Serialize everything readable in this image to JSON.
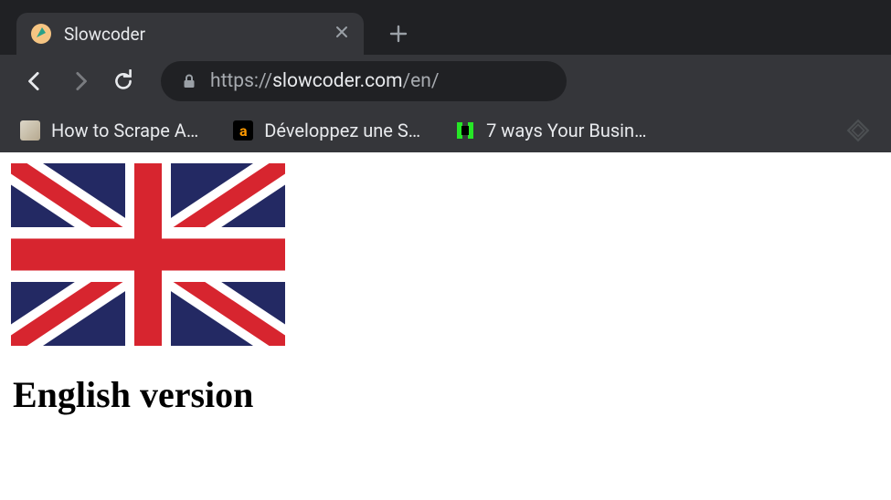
{
  "tab": {
    "title": "Slowcoder",
    "favicon_colors": {
      "bg": "#f6c583",
      "accent": "#2aa188"
    }
  },
  "toolbar": {
    "url_scheme": "https://",
    "url_host": "slowcoder.com",
    "url_path": "/en/"
  },
  "bookmarks": [
    {
      "label": "How to Scrape A…",
      "icon": "face"
    },
    {
      "label": "Développez une S…",
      "icon": "amazon",
      "icon_text": "a"
    },
    {
      "label": "7 ways Your Busin…",
      "icon": "green"
    }
  ],
  "page": {
    "heading": "English version"
  }
}
